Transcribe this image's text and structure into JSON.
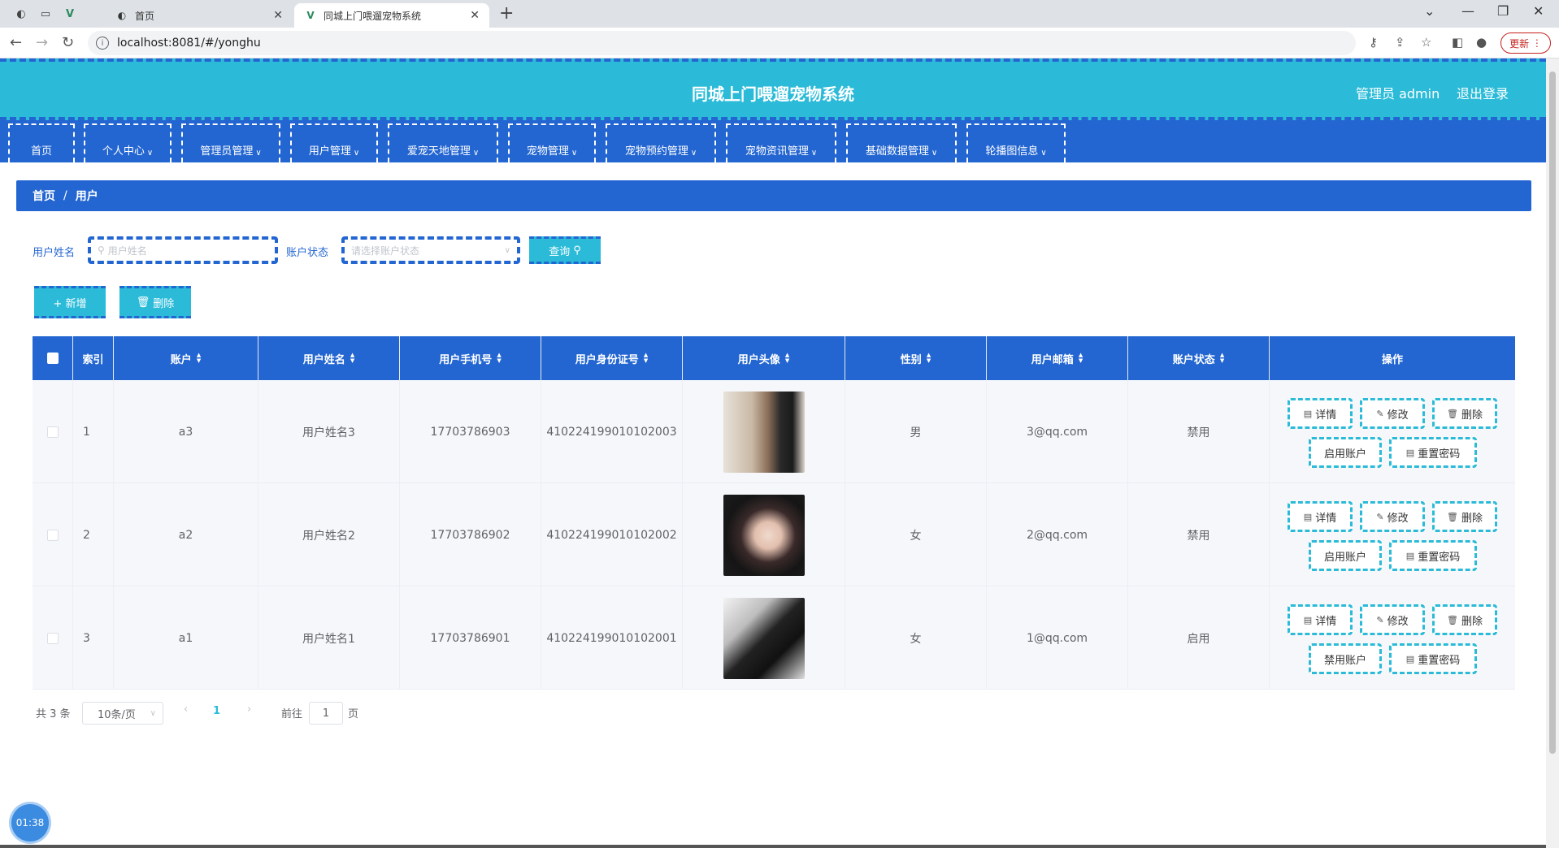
{
  "browser": {
    "tabs": [
      {
        "title": "首页",
        "active": false
      },
      {
        "title": "同城上门喂遛宠物系统",
        "active": true
      }
    ],
    "url": "localhost:8081/#/yonghu",
    "update_label": "更新"
  },
  "header": {
    "title": "同城上门喂遛宠物系统",
    "user": "管理员 admin",
    "logout": "退出登录"
  },
  "menu": [
    {
      "label": "首页",
      "dropdown": false
    },
    {
      "label": "个人中心",
      "dropdown": true
    },
    {
      "label": "管理员管理",
      "dropdown": true
    },
    {
      "label": "用户管理",
      "dropdown": true
    },
    {
      "label": "爱宠天地管理",
      "dropdown": true
    },
    {
      "label": "宠物管理",
      "dropdown": true
    },
    {
      "label": "宠物预约管理",
      "dropdown": true
    },
    {
      "label": "宠物资讯管理",
      "dropdown": true
    },
    {
      "label": "基础数据管理",
      "dropdown": true
    },
    {
      "label": "轮播图信息",
      "dropdown": true
    }
  ],
  "breadcrumb": {
    "home": "首页",
    "separator": "/",
    "current": "用户"
  },
  "search": {
    "name_label": "用户姓名",
    "name_placeholder": "用户姓名",
    "status_label": "账户状态",
    "status_placeholder": "请选择账户状态",
    "query_button": "查询"
  },
  "toolbar": {
    "add": "+ 新增",
    "delete": "删除"
  },
  "table": {
    "headers": {
      "index": "索引",
      "account": "账户",
      "name": "用户姓名",
      "phone": "用户手机号",
      "idcard": "用户身份证号",
      "avatar": "用户头像",
      "gender": "性别",
      "email": "用户邮箱",
      "status": "账户状态",
      "actions": "操作"
    },
    "rows": [
      {
        "index": "1",
        "account": "a3",
        "name": "用户姓名3",
        "phone": "17703786903",
        "idcard": "410224199010102003",
        "gender": "男",
        "email": "3@qq.com",
        "status": "禁用",
        "toggle_label": "启用账户"
      },
      {
        "index": "2",
        "account": "a2",
        "name": "用户姓名2",
        "phone": "17703786902",
        "idcard": "410224199010102002",
        "gender": "女",
        "email": "2@qq.com",
        "status": "禁用",
        "toggle_label": "启用账户"
      },
      {
        "index": "3",
        "account": "a1",
        "name": "用户姓名1",
        "phone": "17703786901",
        "idcard": "410224199010102001",
        "gender": "女",
        "email": "1@qq.com",
        "status": "启用",
        "toggle_label": "禁用账户"
      }
    ],
    "actions": {
      "detail": "详情",
      "edit": "修改",
      "delete": "删除",
      "reset": "重置密码"
    }
  },
  "pagination": {
    "total": "共 3 条",
    "page_size": "10条/页",
    "current": "1",
    "goto_prefix": "前往",
    "goto_value": "1",
    "goto_suffix": "页"
  },
  "timer": "01:38",
  "colors": {
    "primary": "#2366d1",
    "accent": "#2bbbd8"
  }
}
